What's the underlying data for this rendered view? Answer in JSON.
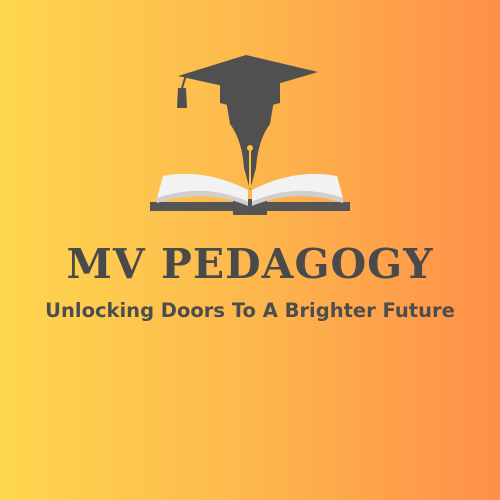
{
  "brand": {
    "name": "MV PEDAGOGY",
    "tagline": "Unlocking Doors To A Brighter Future",
    "logo_icons": [
      "graduation-cap-icon",
      "fountain-pen-nib-icon",
      "open-book-icon"
    ]
  },
  "colors": {
    "gradient_left": "#fed74f",
    "gradient_right": "#fe8f49",
    "text": "#4a4a4a",
    "icon_dark": "#505050",
    "book_pages": "#f2f2f2",
    "book_shadow": "#c9c9c9"
  }
}
